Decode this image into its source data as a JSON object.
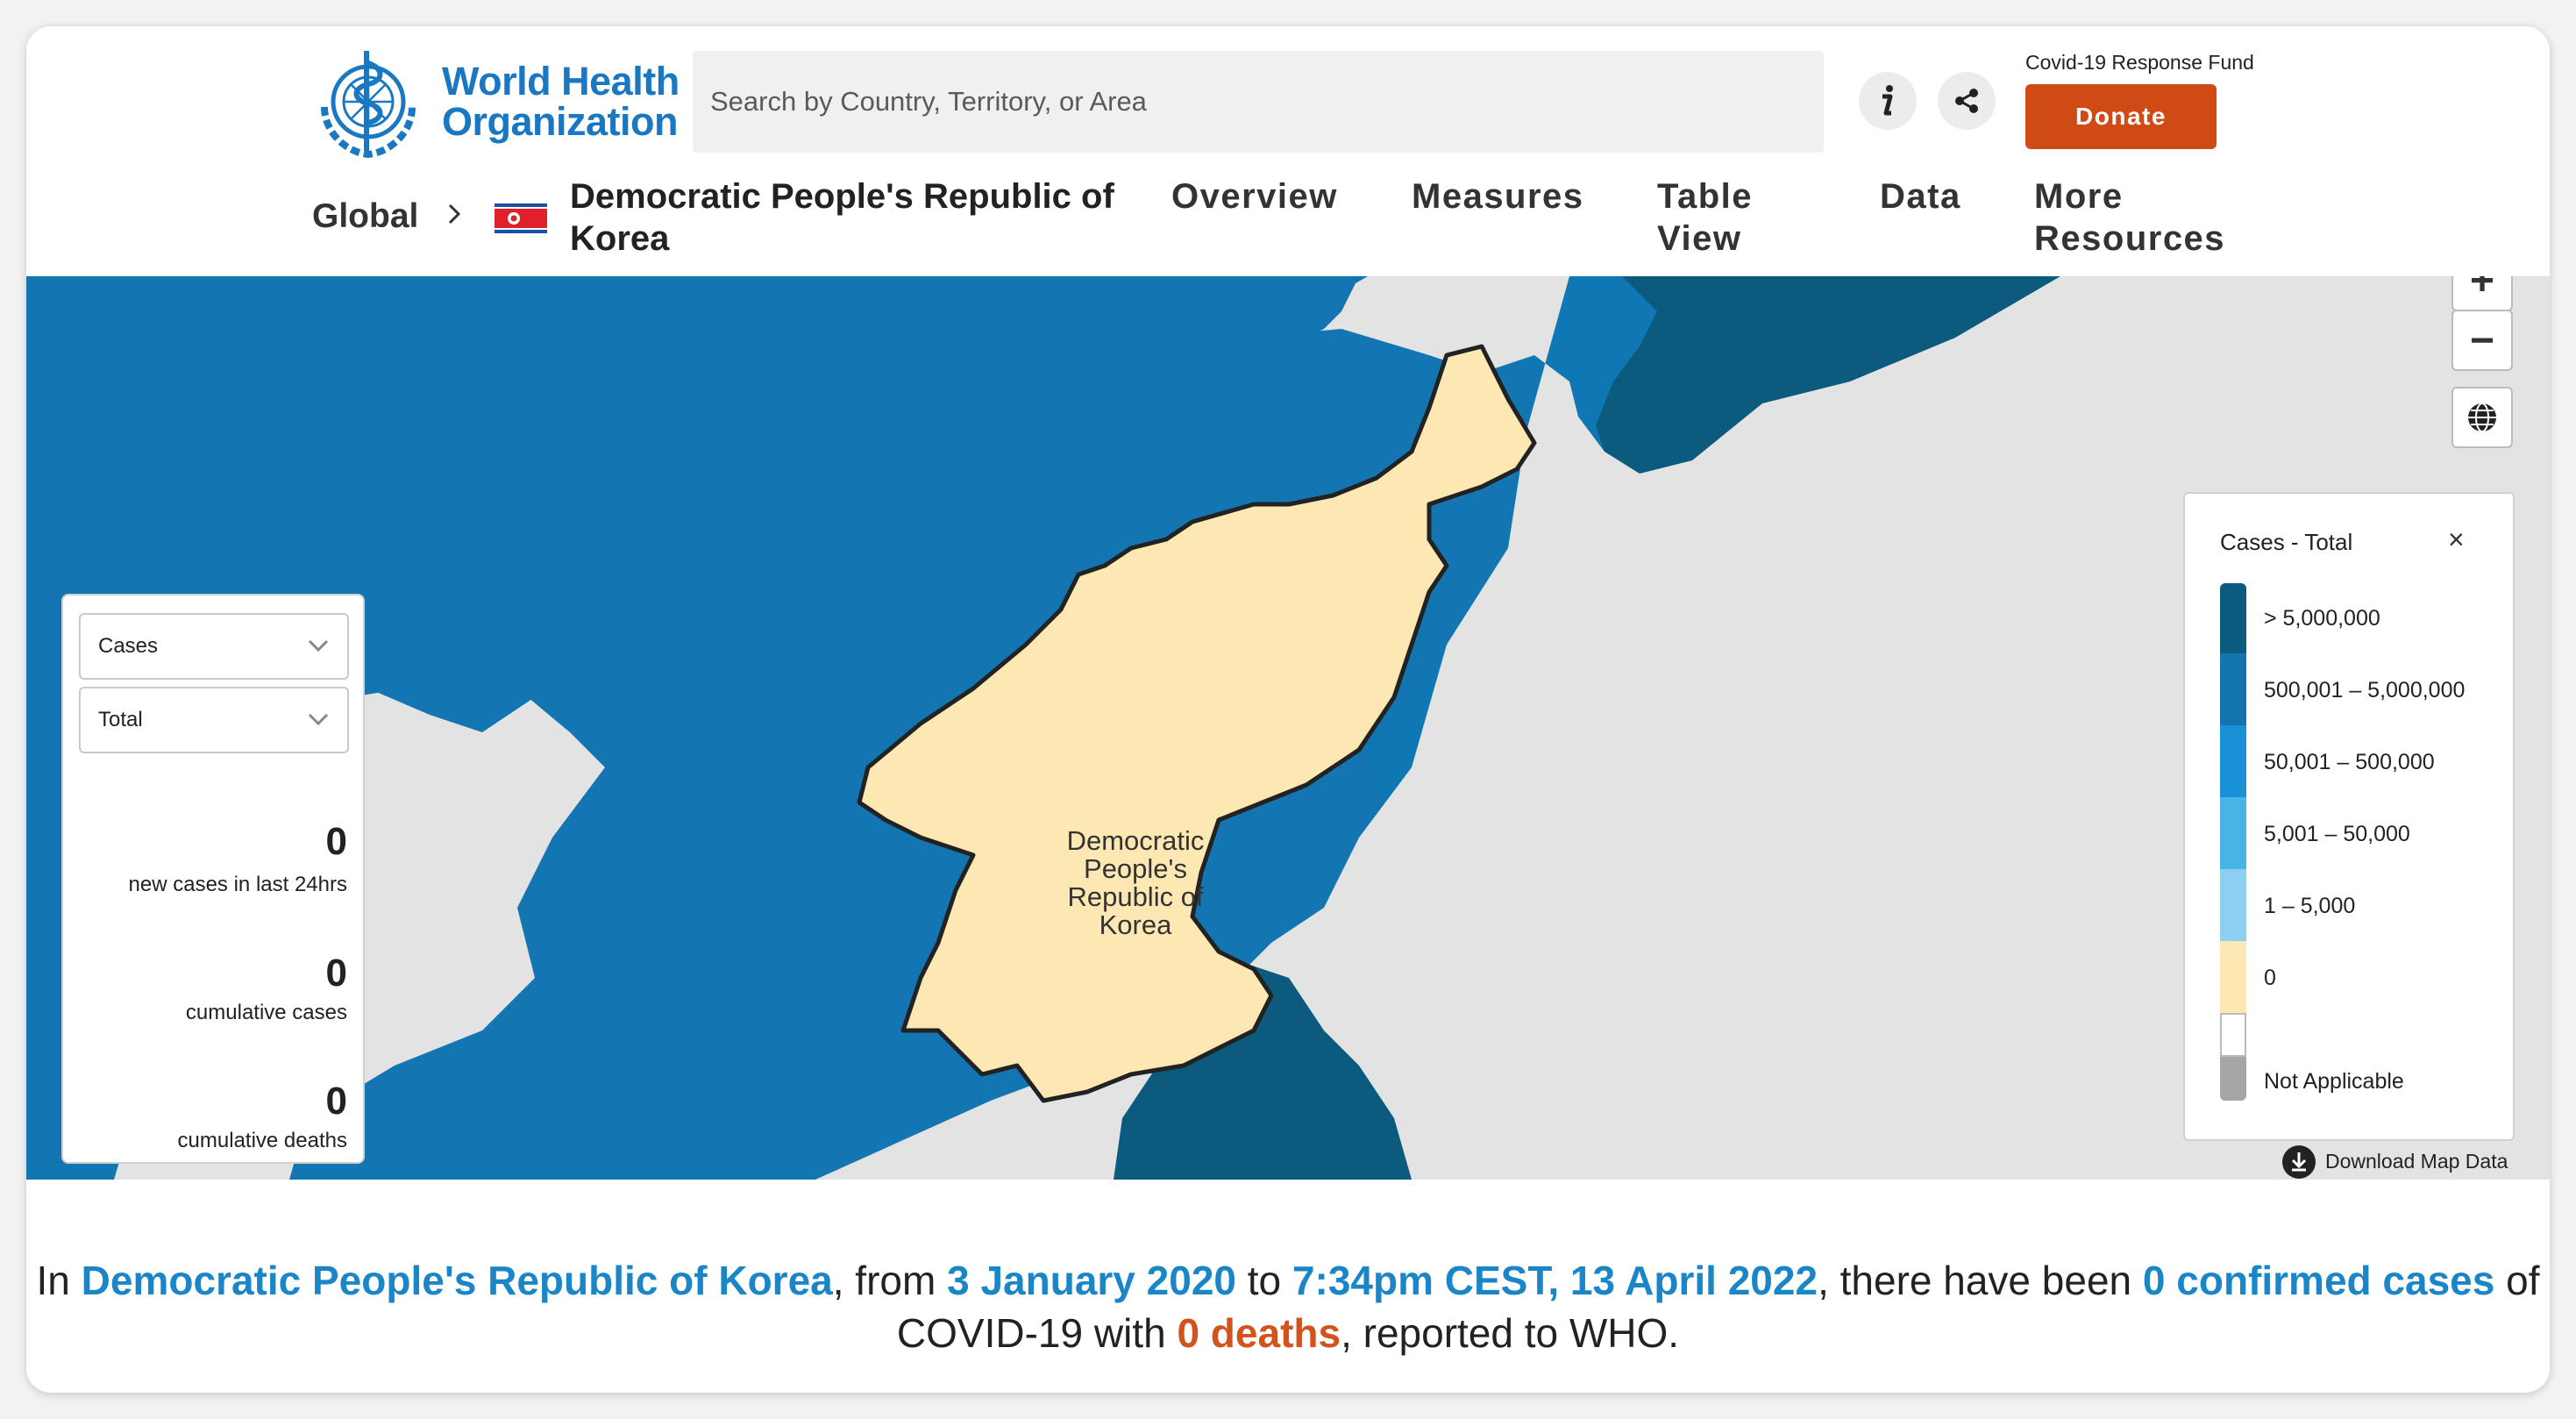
{
  "header": {
    "logo_line1": "World Health",
    "logo_line2": "Organization",
    "search_placeholder": "Search by Country, Territory, or Area",
    "fund_label": "Covid-19 Response Fund",
    "donate_label": "Donate"
  },
  "nav": {
    "global": "Global",
    "country": "Democratic People's Republic of Korea",
    "items": [
      {
        "label": "Overview"
      },
      {
        "label": "Measures"
      },
      {
        "label": "Table View"
      },
      {
        "label": "Data"
      },
      {
        "label": "More Resources"
      }
    ]
  },
  "map": {
    "country_label": "Democratic People's Republic of Korea",
    "zoom_in": "+",
    "zoom_out": "−"
  },
  "stats": {
    "metric_select": "Cases",
    "period_select": "Total",
    "new_cases_value": "0",
    "new_cases_label": "new cases in last 24hrs",
    "cumulative_cases_value": "0",
    "cumulative_cases_label": "cumulative cases",
    "cumulative_deaths_value": "0",
    "cumulative_deaths_label": "cumulative deaths"
  },
  "legend": {
    "title": "Cases - Total",
    "close": "×",
    "items": [
      {
        "label": "> 5,000,000",
        "color": "#0c5a7e"
      },
      {
        "label": "500,001 – 5,000,000",
        "color": "#1474b0"
      },
      {
        "label": "50,001 – 500,000",
        "color": "#1a90d6"
      },
      {
        "label": "5,001 – 50,000",
        "color": "#47b4e6"
      },
      {
        "label": "1 – 5,000",
        "color": "#8ccff0"
      },
      {
        "label": "0",
        "color": "#fde8b4"
      },
      {
        "label": "",
        "color": "#ffffff"
      },
      {
        "label": "Not Applicable",
        "color": "#a6a6a6"
      }
    ],
    "download": "Download Map Data"
  },
  "summary": {
    "t1": "In ",
    "country": "Democratic People's Republic of Korea",
    "t2": ", from ",
    "start_date": "3 January 2020",
    "t3": " to ",
    "end_date": "7:34pm CEST, 13 April 2022",
    "t4": ", there have been ",
    "cases": "0 confirmed cases",
    "t5": " of COVID-19 with ",
    "deaths": "0 deaths",
    "t6": ", reported to WHO."
  }
}
